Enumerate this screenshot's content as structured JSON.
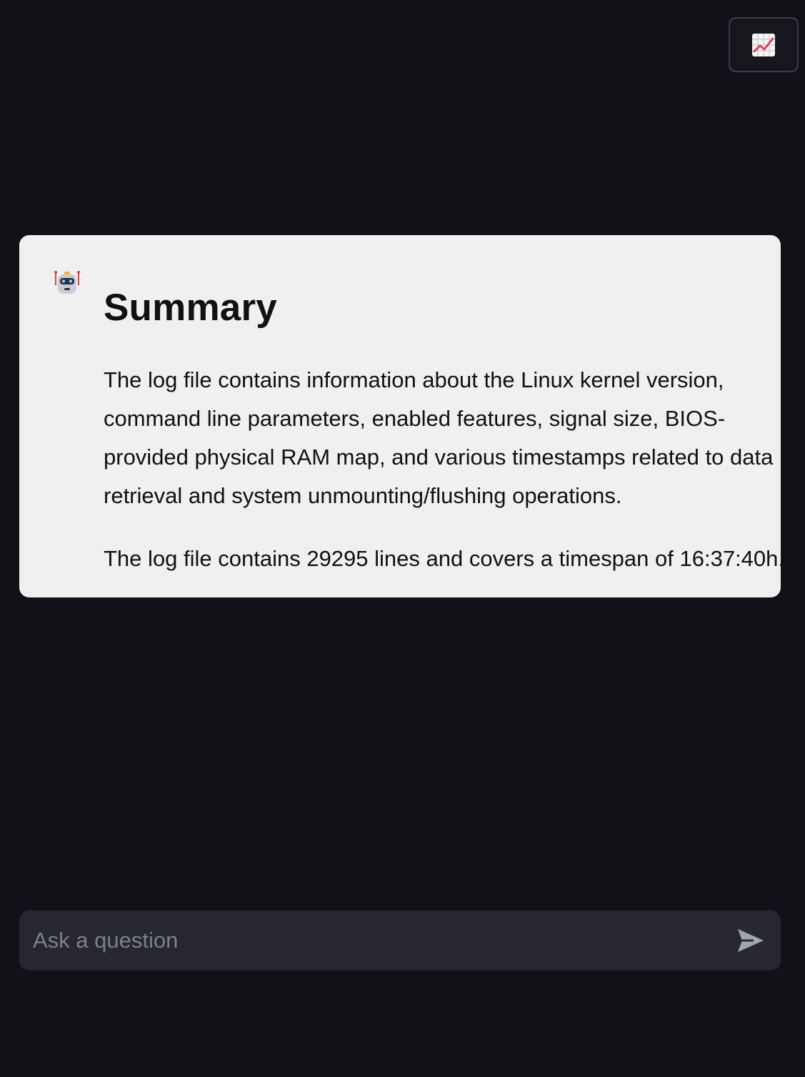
{
  "toolbar": {
    "chart_icon": "chart-increasing-icon"
  },
  "chat": {
    "messages": [
      {
        "avatar_icon": "robot-icon",
        "title": "Summary",
        "paragraphs": [
          "The log file contains information about the Linux kernel version, command line parameters, enabled features, signal size, BIOS-provided physical RAM map, and various timestamps related to data retrieval and system unmounting/flushing operations.",
          "The log file contains 29295 lines and covers a timespan of 16:37:40h."
        ]
      }
    ],
    "input": {
      "placeholder": "Ask a question",
      "value": "",
      "send_icon": "send-icon"
    }
  },
  "colors": {
    "background": "#111218",
    "message_background": "#f0f0f0",
    "input_background": "#262730",
    "chart_icon_line": "#e0405a"
  }
}
